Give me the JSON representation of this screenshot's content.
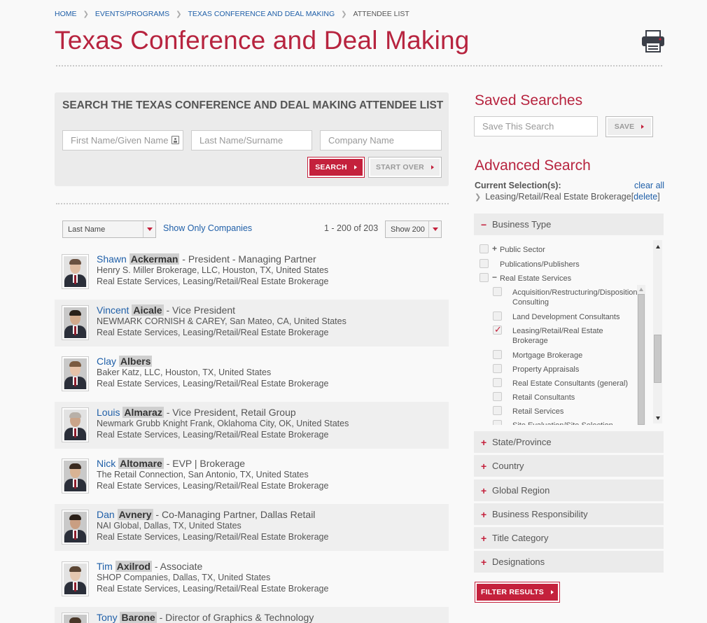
{
  "breadcrumb": {
    "home": "HOME",
    "events": "EVENTS/PROGRAMS",
    "conference": "TEXAS CONFERENCE AND DEAL MAKING",
    "current": "ATTENDEE LIST",
    "separator": "❯"
  },
  "page": {
    "title": "Texas Conference and Deal Making"
  },
  "search": {
    "heading": "SEARCH THE TEXAS CONFERENCE AND DEAL MAKING ATTENDEE LIST",
    "first_name_placeholder": "First Name/Given Name",
    "last_name_placeholder": "Last Name/Surname",
    "company_placeholder": "Company Name",
    "search_label": "SEARCH",
    "start_over_label": "START OVER"
  },
  "results_bar": {
    "sort_value": "Last Name",
    "show_only_companies": "Show Only Companies",
    "count_text": "1 - 200 of 203",
    "per_page_value": "Show 200"
  },
  "attendees": [
    {
      "first": "Shawn",
      "last": "Ackerman",
      "title": " - President - Managing Partner",
      "company": "Henry S. Miller Brokerage, LLC, Houston, TX, United States",
      "categories": "Real Estate Services, Leasing/Retail/Real Estate Brokerage"
    },
    {
      "first": "Vincent",
      "last": "Aicale",
      "title": " - Vice President",
      "company": "NEWMARK CORNISH & CAREY, San Mateo, CA, United States",
      "categories": "Real Estate Services, Leasing/Retail/Real Estate Brokerage"
    },
    {
      "first": "Clay",
      "last": "Albers",
      "title": "",
      "company": "Baker Katz, LLC, Houston, TX, United States",
      "categories": "Real Estate Services, Leasing/Retail/Real Estate Brokerage"
    },
    {
      "first": "Louis",
      "last": "Almaraz",
      "title": " - Vice President, Retail Group",
      "company": "Newmark Grubb Knight Frank, Oklahoma City, OK, United States",
      "categories": "Real Estate Services, Leasing/Retail/Real Estate Brokerage"
    },
    {
      "first": "Nick",
      "last": "Altomare",
      "title": " - EVP | Brokerage",
      "company": "The Retail Connection, San Antonio, TX, United States",
      "categories": "Real Estate Services, Leasing/Retail/Real Estate Brokerage"
    },
    {
      "first": "Dan",
      "last": "Avnery",
      "title": " - Co-Managing Partner, Dallas Retail",
      "company": "NAI Global, Dallas, TX, United States",
      "categories": "Real Estate Services, Leasing/Retail/Real Estate Brokerage"
    },
    {
      "first": "Tim",
      "last": "Axilrod",
      "title": " - Associate",
      "company": "SHOP Companies, Dallas, TX, United States",
      "categories": "Real Estate Services, Leasing/Retail/Real Estate Brokerage"
    },
    {
      "first": "Tony",
      "last": "Barone",
      "title": " - Director of Graphics & Technology",
      "company": "",
      "categories": ""
    }
  ],
  "saved_searches": {
    "title": "Saved Searches",
    "input_placeholder": "Save This Search",
    "save_label": "SAVE"
  },
  "advanced": {
    "title": "Advanced Search",
    "current_selection_label": "Current Selection(s):",
    "clear_all": "clear all",
    "selection_chevron": "❯",
    "selection_text": "Leasing/Retail/Real Estate Brokerage",
    "bracket_open": "[",
    "delete_label": "delete",
    "bracket_close": "]",
    "business_type": {
      "label": "Business Type",
      "sign": "−",
      "rows": [
        {
          "sign": "+",
          "label": "Public Sector"
        },
        {
          "sign": "",
          "label": "Publications/Publishers"
        },
        {
          "sign": "−",
          "label": "Real Estate Services"
        },
        {
          "label": "Acquisition/Restructuring/Disposition"
        },
        {
          "label": "Consulting"
        },
        {
          "label": "Land Development Consultants"
        },
        {
          "label": "Leasing/Retail/Real Estate"
        },
        {
          "label": "Brokerage"
        },
        {
          "label": "Mortgage Brokerage"
        },
        {
          "label": "Property Appraisals"
        },
        {
          "label": "Real Estate Consultants (general)"
        },
        {
          "label": "Retail Consultants"
        },
        {
          "label": "Retail Services"
        },
        {
          "label": "Site Evaluation/Site Selection"
        }
      ]
    },
    "sections": [
      {
        "sign": "+",
        "label": "State/Province"
      },
      {
        "sign": "+",
        "label": "Country"
      },
      {
        "sign": "+",
        "label": "Global Region"
      },
      {
        "sign": "+",
        "label": "Business Responsibility"
      },
      {
        "sign": "+",
        "label": "Title Category"
      },
      {
        "sign": "+",
        "label": "Designations"
      }
    ],
    "filter_label": "FILTER RESULTS"
  },
  "icons": {
    "print": "printer-icon",
    "contact_card": "contact-card-icon",
    "caret": "caret-down-icon",
    "arrow": "arrow-right-icon"
  },
  "colors": {
    "brand_red": "#b7243f",
    "button_red": "#c4213c",
    "link_blue": "#1f5fa8",
    "panel_grey": "#ebebeb"
  }
}
